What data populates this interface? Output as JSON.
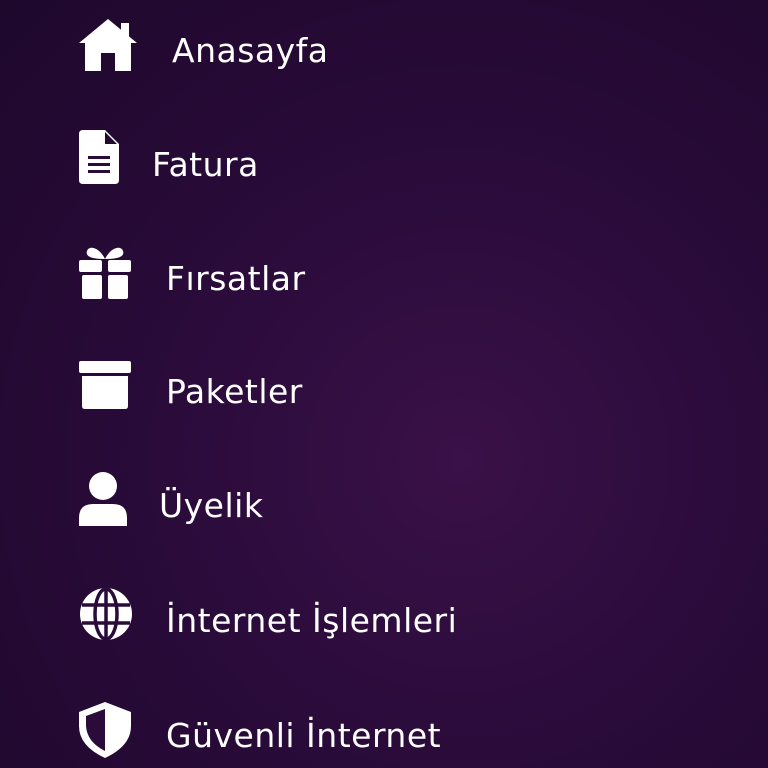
{
  "theme": {
    "background": "#2a0b3a",
    "text_color": "#ffffff",
    "icon_color": "#ffffff"
  },
  "menu": {
    "items": [
      {
        "label": "Anasayfa",
        "icon": "home-icon"
      },
      {
        "label": "Fatura",
        "icon": "document-icon"
      },
      {
        "label": "Fırsatlar",
        "icon": "gift-icon"
      },
      {
        "label": "Paketler",
        "icon": "archive-box-icon"
      },
      {
        "label": "Üyelik",
        "icon": "user-icon"
      },
      {
        "label": "İnternet İşlemleri",
        "icon": "globe-icon"
      },
      {
        "label": "Güvenli İnternet",
        "icon": "shield-icon"
      }
    ]
  }
}
